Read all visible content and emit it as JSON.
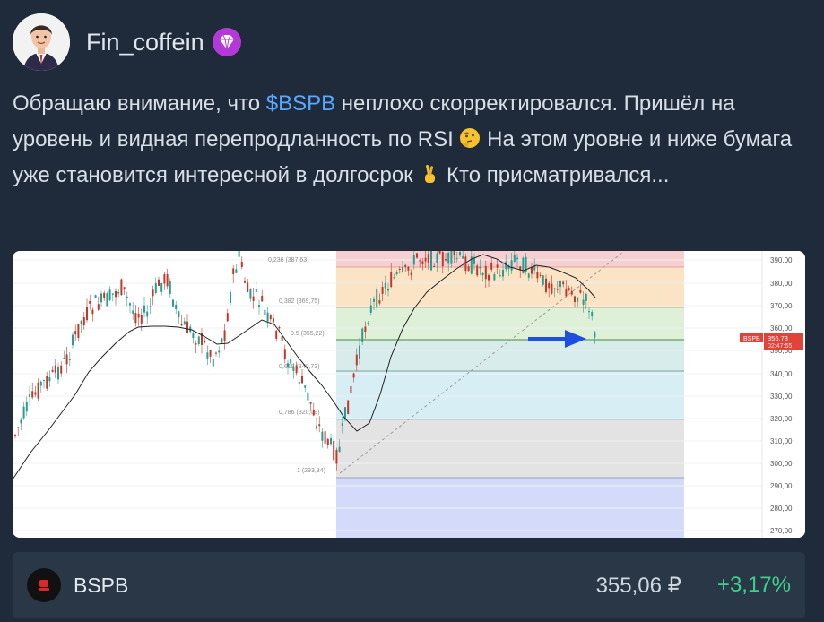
{
  "author": {
    "name": "Fin_coffein",
    "badge_icon": "gem-icon"
  },
  "post": {
    "text_part1": "Обращаю внимание, что ",
    "ticker_link": "$BSPB",
    "text_part2": " неплохо скорректировался. Пришёл на уровень и видная перепродланность по RSI ",
    "text_part3": " На этом уровне и ниже бумага уже становится интересной в долгосрок ",
    "text_part4": " Кто присматривался..."
  },
  "chart": {
    "price_label": "BSPB",
    "price_value": "356,73",
    "price_time": "02:47:55",
    "y_ticks": [
      "390,00",
      "380,00",
      "370,00",
      "360,00",
      "350,00",
      "340,00",
      "330,00",
      "320,00",
      "310,00",
      "300,00",
      "290,00",
      "280,00",
      "270,00"
    ],
    "fib_labels": [
      "0,236 (387,63)",
      "0,382 (369,75)",
      "0.5 (355,22)",
      "0,618 (340,73)",
      "0,786 (320,09)",
      "1 (293,84)"
    ],
    "colors": {
      "arrow": "#1f4fe0",
      "price_tag": "#e0433a"
    }
  },
  "footer": {
    "ticker": "BSPB",
    "price": "355,06 ₽",
    "change": "+3,17%",
    "change_color": "#3ed08a"
  }
}
